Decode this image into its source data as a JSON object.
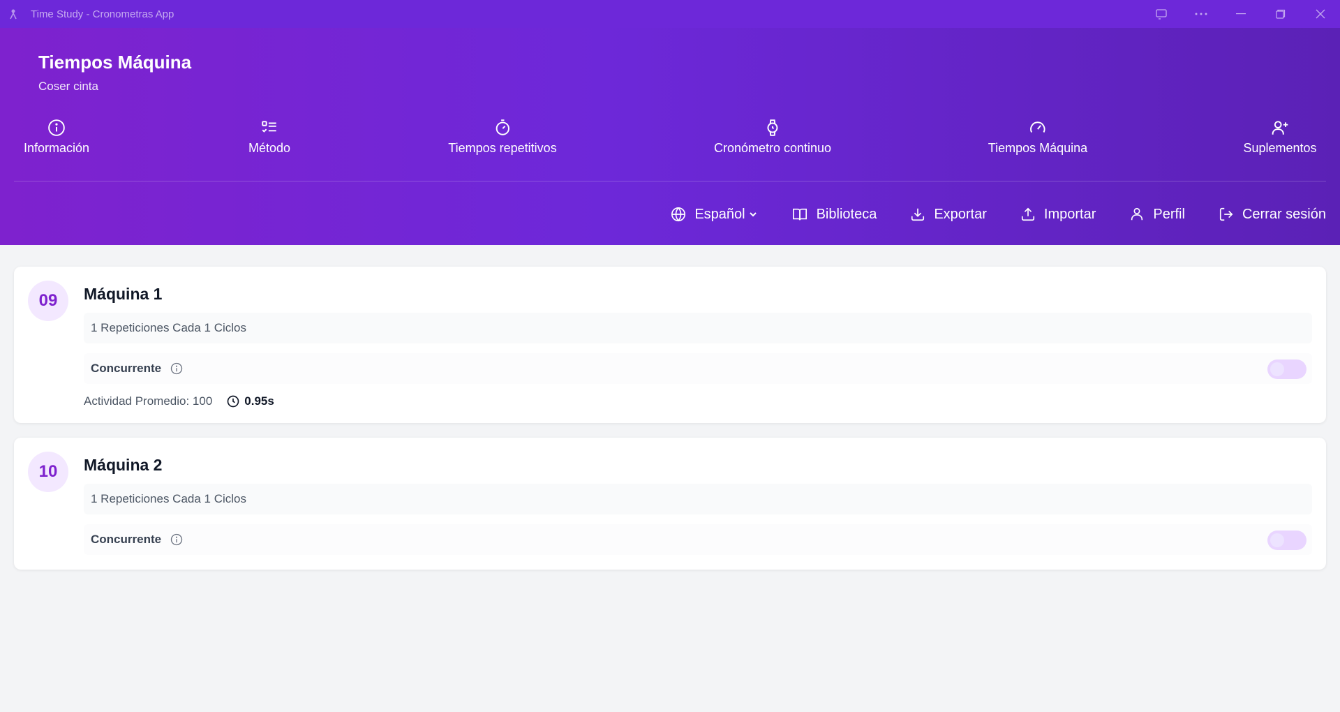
{
  "window": {
    "title": "Time Study - Cronometras App"
  },
  "header": {
    "title": "Tiempos Máquina",
    "subtitle": "Coser cinta"
  },
  "nav": [
    {
      "label": "Información",
      "icon": "info-icon"
    },
    {
      "label": "Método",
      "icon": "list-check-icon"
    },
    {
      "label": "Tiempos repetitivos",
      "icon": "stopwatch-icon"
    },
    {
      "label": "Cronómetro continuo",
      "icon": "watch-icon"
    },
    {
      "label": "Tiempos Máquina",
      "icon": "gauge-icon"
    },
    {
      "label": "Suplementos",
      "icon": "user-plus-icon"
    }
  ],
  "toolbar": {
    "language": "Español",
    "library": "Biblioteca",
    "export": "Exportar",
    "import": "Importar",
    "profile": "Perfil",
    "logout": "Cerrar sesión"
  },
  "machines": [
    {
      "number": "09",
      "name": "Máquina 1",
      "repetitions": "1 Repeticiones Cada 1 Ciclos",
      "concurrent_label": "Concurrente",
      "concurrent_on": false,
      "activity": "Actividad Promedio: 100",
      "time": "0.95s"
    },
    {
      "number": "10",
      "name": "Máquina 2",
      "repetitions": "1 Repeticiones Cada 1 Ciclos",
      "concurrent_label": "Concurrente",
      "concurrent_on": false
    }
  ],
  "colors": {
    "accent": "#7e22ce",
    "header_start": "#7e22ce",
    "header_end": "#5b21b6",
    "toggle_off": "#e9d5ff"
  }
}
